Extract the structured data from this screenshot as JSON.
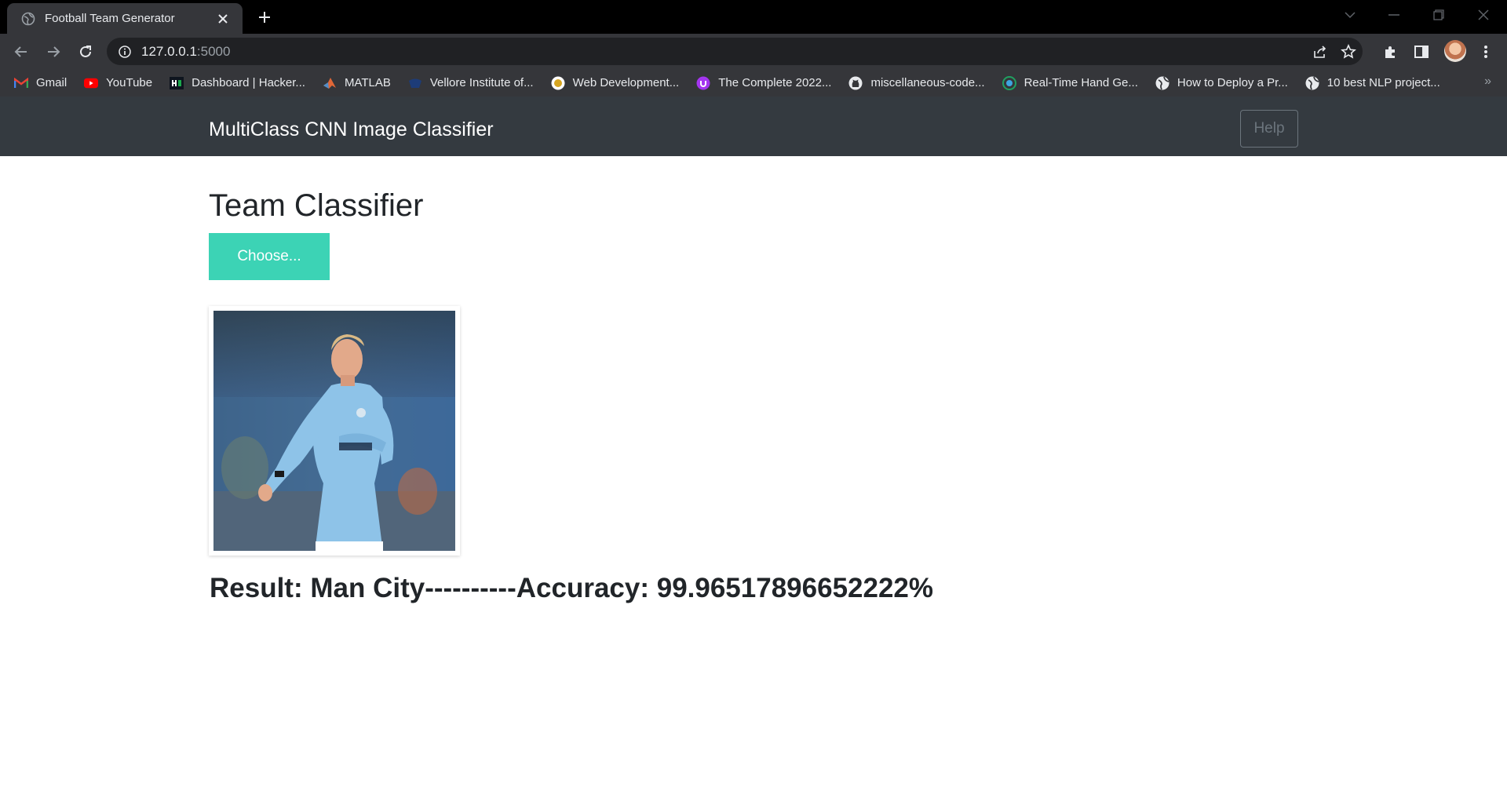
{
  "browser": {
    "tab_title": "Football Team Generator",
    "url_host": "127.0.0.1",
    "url_port": ":5000",
    "bookmarks": [
      {
        "label": "Gmail",
        "icon": "gmail-icon"
      },
      {
        "label": "YouTube",
        "icon": "youtube-icon"
      },
      {
        "label": "Dashboard | Hacker...",
        "icon": "hackerrank-icon"
      },
      {
        "label": "MATLAB",
        "icon": "matlab-icon"
      },
      {
        "label": "Vellore Institute of...",
        "icon": "vit-icon"
      },
      {
        "label": "Web Development...",
        "icon": "udemy-icon"
      },
      {
        "label": "The Complete 2022...",
        "icon": "udemy-purple-icon"
      },
      {
        "label": "miscellaneous-code...",
        "icon": "github-icon"
      },
      {
        "label": "Real-Time Hand Ge...",
        "icon": "hand-icon"
      },
      {
        "label": "How to Deploy a Pr...",
        "icon": "globe-icon"
      },
      {
        "label": "10 best NLP project...",
        "icon": "globe-icon"
      }
    ],
    "bookmarks_more": "»"
  },
  "navbar": {
    "brand": "MultiClass CNN Image Classifier",
    "help_label": "Help"
  },
  "main": {
    "title": "Team Classifier",
    "choose_label": "Choose...",
    "result_text": "Result: Man City----------Accuracy: 99.96517896652222%"
  },
  "colors": {
    "navbar_bg": "#343a40",
    "choose_bg": "#3cd3b5",
    "chrome_bg": "#35363a"
  }
}
